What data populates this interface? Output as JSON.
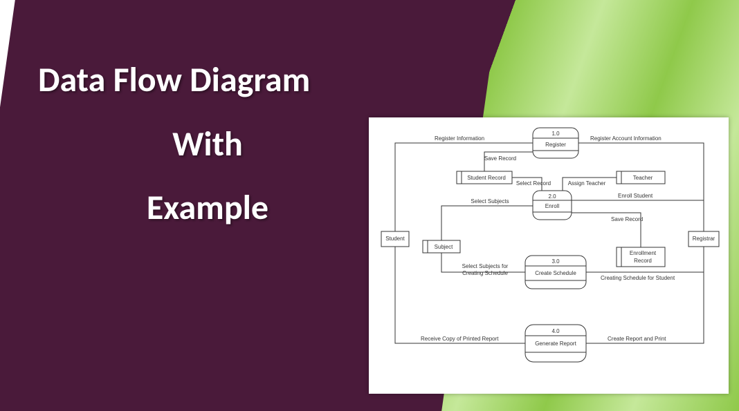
{
  "title": {
    "line1": "Data Flow Diagram",
    "line2": "With",
    "line3": "Example"
  },
  "diagram": {
    "externals": {
      "student": "Student",
      "registrar": "Registrar"
    },
    "processes": {
      "p1_id": "1.0",
      "p1_name": "Register",
      "p2_id": "2.0",
      "p2_name": "Enroll",
      "p3_id": "3.0",
      "p3_name": "Create Schedule",
      "p4_id": "4.0",
      "p4_name": "Generate Report"
    },
    "datastores": {
      "ds1": "Student Record",
      "ds2": "Teacher",
      "ds3": "Subject",
      "ds4": "Enrollment Record"
    },
    "flows": {
      "f1": "Register Information",
      "f2": "Register Account Information",
      "f3": "Save Record",
      "f4": "Select Record",
      "f5": "Assign Teacher",
      "f6": "Select Subjects",
      "f7": "Enroll Student",
      "f8": "Save Record",
      "f9": "Select Subjects for",
      "f9b": "Creating Schedule",
      "f10": "Creating Schedule for Student",
      "f11": "Receive Copy of Printed Report",
      "f12": "Create Report and Print"
    }
  }
}
